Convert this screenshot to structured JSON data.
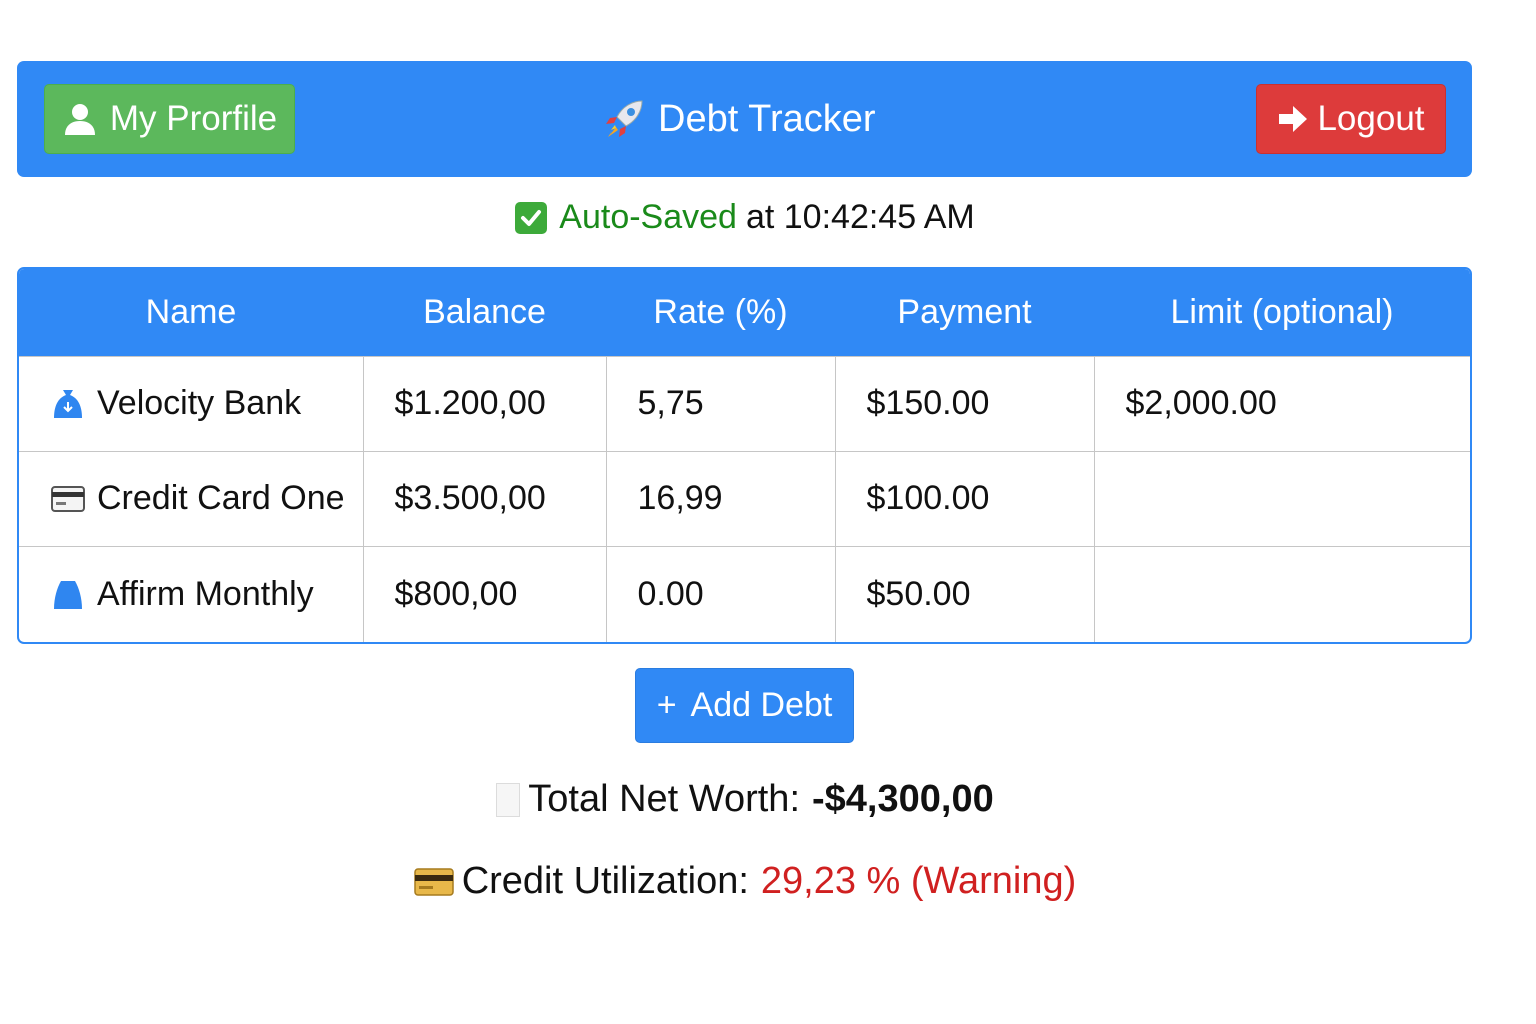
{
  "header": {
    "profile_label": "My Prorfile",
    "profile_icon": "user-icon",
    "title": "Debt Tracker",
    "title_icon": "rocket-icon",
    "logout_label": "Logout",
    "logout_icon": "arrow-right-icon"
  },
  "save_status": {
    "icon": "check-box-icon",
    "highlight": "Auto-Saved",
    "rest": "at 10:42:45 AM"
  },
  "table": {
    "columns": [
      "Name",
      "Balance",
      "Rate (%)",
      "Payment",
      "Limit (optional)"
    ],
    "rows": [
      {
        "icon": "bank-bag-icon",
        "name": "Velocity Bank",
        "balance": "$1.200,00",
        "rate": "5,75",
        "payment": "$150.00",
        "limit": "$2,000.00"
      },
      {
        "icon": "credit-card-icon",
        "name": "Credit Card One",
        "balance": "$3.500,00",
        "rate": "16,99",
        "payment": "$100.00",
        "limit": ""
      },
      {
        "icon": "bag-icon",
        "name": "Affirm Monthly",
        "balance": "$800,00",
        "rate": "0.00",
        "payment": "$50.00",
        "limit": ""
      }
    ]
  },
  "add_button": {
    "label": "Add Debt",
    "plus": "+"
  },
  "summary": {
    "networth_label": "Total Net Worth:",
    "networth_value": "-$4,300,00",
    "utilization_label": "Credit Utilization:",
    "utilization_value": "29,23 % (Warning)"
  },
  "colors": {
    "primary": "#3089f5",
    "success": "#5cb85c",
    "danger": "#dd3b3b",
    "saved_green": "#1a8a1a",
    "warning_red": "#d02020"
  }
}
